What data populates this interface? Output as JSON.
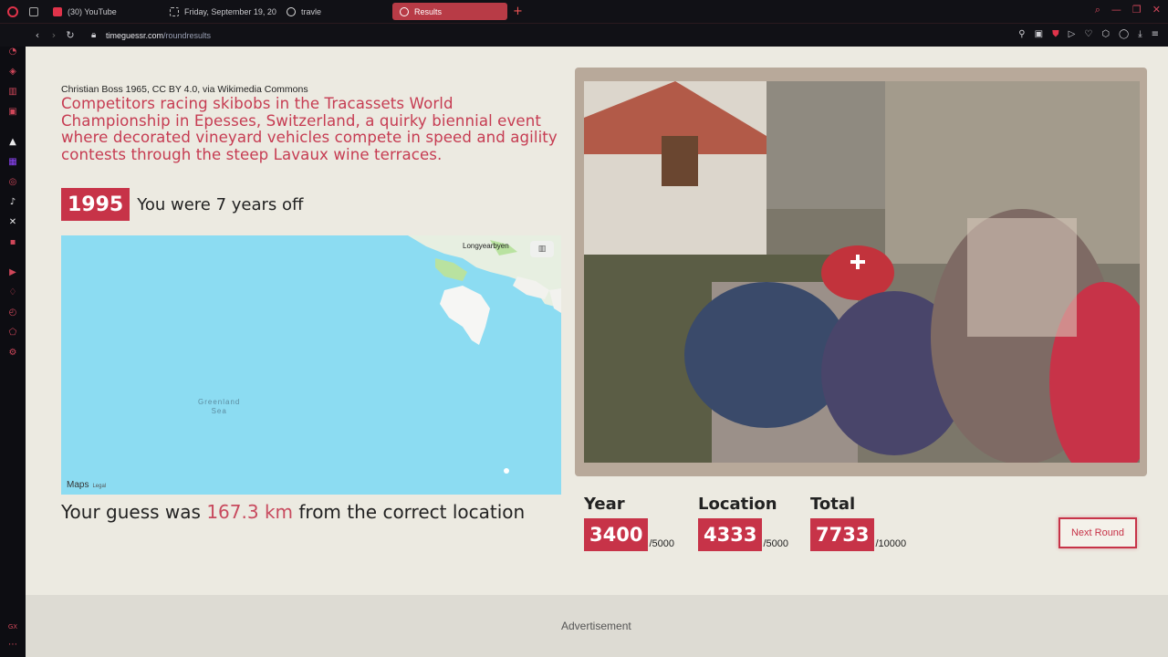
{
  "browser": {
    "tabs": [
      {
        "label": "(30) YouTube",
        "color": "#e0334a"
      },
      {
        "label": "Friday, September 19, 20",
        "color": "#bbbbbb"
      },
      {
        "label": "travle",
        "color": "#dddddd"
      },
      {
        "label": "Results",
        "color": "#ffffff",
        "active": true
      }
    ],
    "url_host": "timeguessr.com",
    "url_path": "/roundresults"
  },
  "result": {
    "credit": "Christian Boss 1965, CC BY 4.0, via Wikimedia Commons",
    "description": "Competitors racing skibobs in the Tracassets World Championship in Epesses, Switzerland, a quirky biennial event where decorated vineyard vehicles compete in speed and agility contests through the steep Lavaux wine terraces.",
    "year": "1995",
    "year_off_text": "You were 7 years off",
    "distance_prefix": "Your guess was ",
    "distance_value": "167.3 km",
    "distance_suffix": " from the correct location"
  },
  "map": {
    "city_label": "Longyearbyen",
    "sea_label_1": "Greenland",
    "sea_label_2": "Sea",
    "attribution": "Maps",
    "legal": "Legal"
  },
  "scores": {
    "year_label": "Year",
    "year_value": "3400",
    "year_max": "/5000",
    "location_label": "Location",
    "location_value": "4333",
    "location_max": "/5000",
    "total_label": "Total",
    "total_value": "7733",
    "total_max": "/10000"
  },
  "next_button": "Next Round",
  "ad_label": "Advertisement",
  "colors": {
    "accent": "#c73348",
    "page_bg": "#eceae1",
    "map_water": "#8cdcf2"
  }
}
